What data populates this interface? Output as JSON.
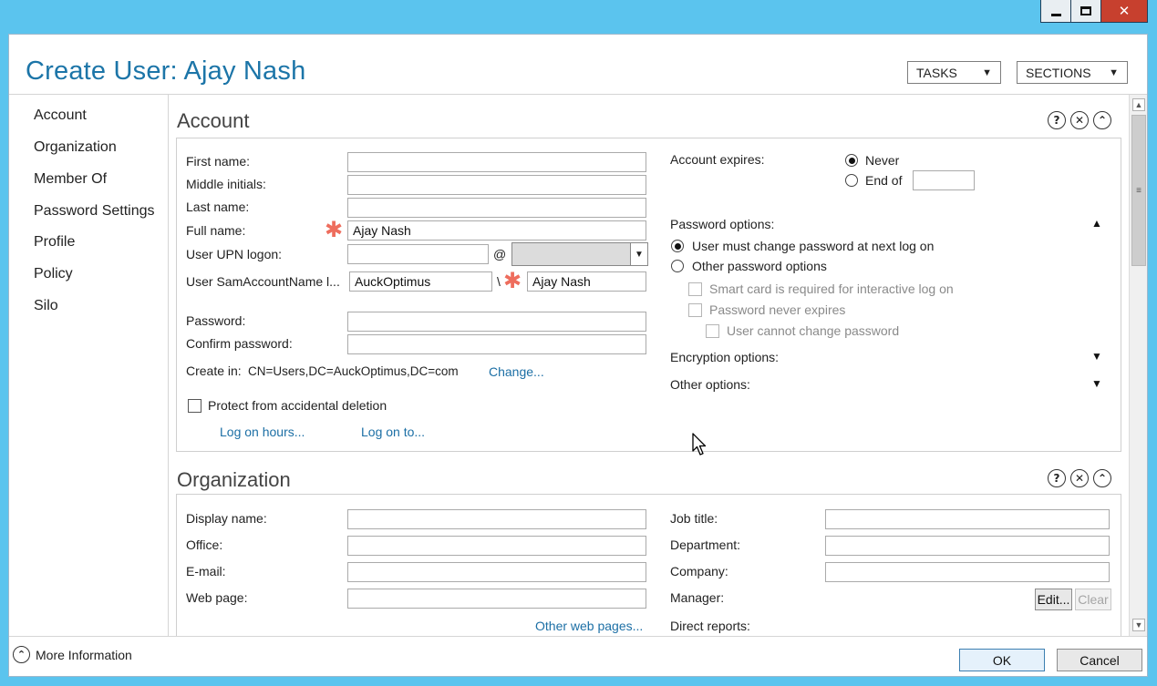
{
  "window": {
    "minimize_glyph": "",
    "maximize_glyph": "",
    "close_glyph": "✕"
  },
  "header": {
    "title": "Create User: Ajay Nash",
    "tasks_label": "TASKS",
    "sections_label": "SECTIONS",
    "dropdown_glyph": "▼"
  },
  "nav": {
    "items": [
      "Account",
      "Organization",
      "Member Of",
      "Password Settings",
      "Profile",
      "Policy",
      "Silo"
    ]
  },
  "account": {
    "title": "Account",
    "help_glyph": "?",
    "close_glyph": "✕",
    "collapse_glyph": "⌃",
    "first_name_label": "First name:",
    "first_name_value": "",
    "middle_initials_label": "Middle initials:",
    "middle_initials_value": "",
    "last_name_label": "Last name:",
    "last_name_value": "",
    "full_name_label": "Full name:",
    "full_name_value": "Ajay Nash",
    "required_glyph": "✱",
    "upn_label": "User UPN logon:",
    "upn_value": "",
    "at_sign": "@",
    "upn_domain_value": "",
    "sam_label": "User SamAccountName l...",
    "sam_domain_value": "AuckOptimus",
    "sam_separator": "\\",
    "sam_value": "Ajay Nash",
    "password_label": "Password:",
    "confirm_password_label": "Confirm password:",
    "create_in_label": "Create in:",
    "create_in_value": "CN=Users,DC=AuckOptimus,DC=com",
    "change_link": "Change...",
    "protect_label": "Protect from accidental deletion",
    "logon_hours_link": "Log on hours...",
    "logon_to_link": "Log on to...",
    "account_expires_label": "Account expires:",
    "never_label": "Never",
    "end_of_label": "End of",
    "end_of_value": "",
    "password_options_label": "Password options:",
    "must_change_label": "User must change password at next log on",
    "other_options_label": "Other password options",
    "smart_card_label": "Smart card is required for interactive log on",
    "never_expires_label": "Password never expires",
    "cannot_change_label": "User cannot change password",
    "encryption_options_label": "Encryption options:",
    "other_options_section_label": "Other options:",
    "expand_up_glyph": "▲",
    "expand_down_glyph": "▼"
  },
  "organization": {
    "title": "Organization",
    "display_name_label": "Display name:",
    "office_label": "Office:",
    "email_label": "E-mail:",
    "web_page_label": "Web page:",
    "other_web_pages_link": "Other web pages...",
    "job_title_label": "Job title:",
    "department_label": "Department:",
    "company_label": "Company:",
    "manager_label": "Manager:",
    "edit_button": "Edit...",
    "clear_button": "Clear",
    "direct_reports_label": "Direct reports:"
  },
  "footer": {
    "more_info_label": "More Information",
    "more_info_glyph": "⌃",
    "ok_label": "OK",
    "cancel_label": "Cancel"
  },
  "scrollbar": {
    "up_glyph": "▲",
    "down_glyph": "▼",
    "grip_glyph": "≡"
  }
}
